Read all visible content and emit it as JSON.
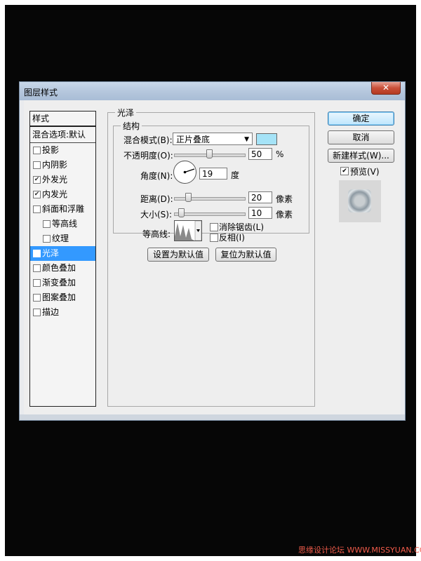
{
  "dialog": {
    "title": "图层样式",
    "close_label": "✕"
  },
  "style_list": {
    "header": "样式",
    "blend_options": "混合选项:默认",
    "items": [
      {
        "label": "投影",
        "checked": false
      },
      {
        "label": "内阴影",
        "checked": false
      },
      {
        "label": "外发光",
        "checked": true
      },
      {
        "label": "内发光",
        "checked": true
      },
      {
        "label": "斜面和浮雕",
        "checked": false
      },
      {
        "label": "等高线",
        "checked": false
      },
      {
        "label": "纹理",
        "checked": false
      },
      {
        "label": "光泽",
        "checked": true
      },
      {
        "label": "颜色叠加",
        "checked": false
      },
      {
        "label": "渐变叠加",
        "checked": false
      },
      {
        "label": "图案叠加",
        "checked": false
      },
      {
        "label": "描边",
        "checked": false
      }
    ]
  },
  "satin": {
    "group_title": "光泽",
    "structure_title": "结构",
    "blend_mode_label": "混合模式(B):",
    "blend_mode_value": "正片叠底",
    "blend_color": "#a5e3f7",
    "opacity_label": "不透明度(O):",
    "opacity_value": "50",
    "opacity_unit": "%",
    "angle_label": "角度(N):",
    "angle_value": "19",
    "angle_unit": "度",
    "distance_label": "距离(D):",
    "distance_value": "20",
    "distance_unit": "像素",
    "size_label": "大小(S):",
    "size_value": "10",
    "size_unit": "像素",
    "contour_label": "等高线:",
    "antialias_label": "消除锯齿(L)",
    "invert_label": "反相(I)",
    "set_default_label": "设置为默认值",
    "reset_default_label": "复位为默认值"
  },
  "side": {
    "ok_label": "确定",
    "cancel_label": "取消",
    "new_style_label": "新建样式(W)...",
    "preview_label": "预览(V)",
    "preview_checked": true
  },
  "watermark": "思缘设计论坛 WWW.MISSYUAN.COM"
}
